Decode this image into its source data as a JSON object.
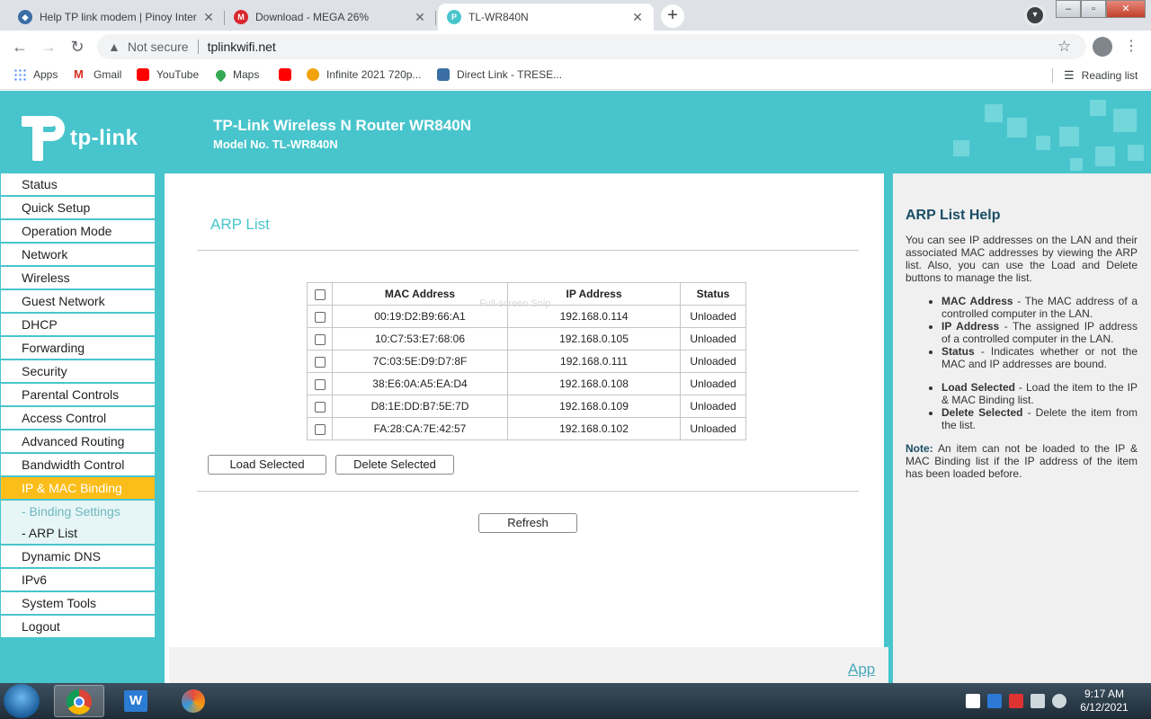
{
  "browser": {
    "tabs": [
      {
        "title": "Help TP link modem | Pinoy Inter",
        "active": false
      },
      {
        "title": "Download - MEGA 26%",
        "active": false
      },
      {
        "title": "TL-WR840N",
        "active": true
      }
    ],
    "new_tab": "+",
    "close_glyph": "✕",
    "security_label": "Not secure",
    "url": "tplinkwifi.net",
    "bookmarks": [
      "Apps",
      "Gmail",
      "YouTube",
      "Maps",
      "",
      "Infinite 2021 720p...",
      "Direct Link - TRESE..."
    ],
    "reading_list": "Reading list"
  },
  "header": {
    "logo_text": "tp-link",
    "title": "TP-Link Wireless N Router WR840N",
    "model": "Model No. TL-WR840N"
  },
  "menu": {
    "items": [
      "Status",
      "Quick Setup",
      "Operation Mode",
      "Network",
      "Wireless",
      "Guest Network",
      "DHCP",
      "Forwarding",
      "Security",
      "Parental Controls",
      "Access Control",
      "Advanced Routing",
      "Bandwidth Control",
      "IP & MAC Binding"
    ],
    "sub_items": [
      "- Binding Settings",
      "- ARP List"
    ],
    "items_after": [
      "Dynamic DNS",
      "IPv6",
      "System Tools",
      "Logout"
    ],
    "active": "IP & MAC Binding"
  },
  "content": {
    "section_title": "ARP List",
    "columns": [
      "MAC Address",
      "IP Address",
      "Status"
    ],
    "rows": [
      {
        "mac": "00:19:D2:B9:66:A1",
        "ip": "192.168.0.114",
        "status": "Unloaded"
      },
      {
        "mac": "10:C7:53:E7:68:06",
        "ip": "192.168.0.105",
        "status": "Unloaded"
      },
      {
        "mac": "7C:03:5E:D9:D7:8F",
        "ip": "192.168.0.111",
        "status": "Unloaded"
      },
      {
        "mac": "38:E6:0A:A5:EA:D4",
        "ip": "192.168.0.108",
        "status": "Unloaded"
      },
      {
        "mac": "D8:1E:DD:B7:5E:7D",
        "ip": "192.168.0.109",
        "status": "Unloaded"
      },
      {
        "mac": "FA:28:CA:7E:42:57",
        "ip": "192.168.0.102",
        "status": "Unloaded"
      }
    ],
    "ghost_text": "Full-screen Snip",
    "load_button": "Load Selected",
    "delete_button": "Delete Selected",
    "refresh_button": "Refresh",
    "app_link": "App"
  },
  "help": {
    "title": "ARP List Help",
    "intro": "You can see IP addresses on the LAN and their associated MAC addresses by viewing the ARP list. Also, you can use the Load and Delete buttons to manage the list.",
    "bullets1": [
      {
        "term": "MAC Address",
        "desc": " - The MAC address of a controlled computer in the LAN."
      },
      {
        "term": "IP Address",
        "desc": " - The assigned IP address of a controlled computer in the LAN."
      },
      {
        "term": "Status",
        "desc": " - Indicates whether or not the MAC and IP addresses are bound."
      }
    ],
    "bullets2": [
      {
        "term": "Load Selected",
        "desc": " - Load the item to the IP & MAC Binding list."
      },
      {
        "term": "Delete Selected",
        "desc": " - Delete the item from the list."
      }
    ],
    "note_label": "Note:",
    "note": " An item can not be loaded to the IP & MAC Binding list if the IP address of the item has been loaded before."
  },
  "taskbar": {
    "time": "9:17 AM",
    "date": "6/12/2021"
  },
  "colors": {
    "brand": "#48c5cc",
    "active_menu": "#fbbd19"
  }
}
